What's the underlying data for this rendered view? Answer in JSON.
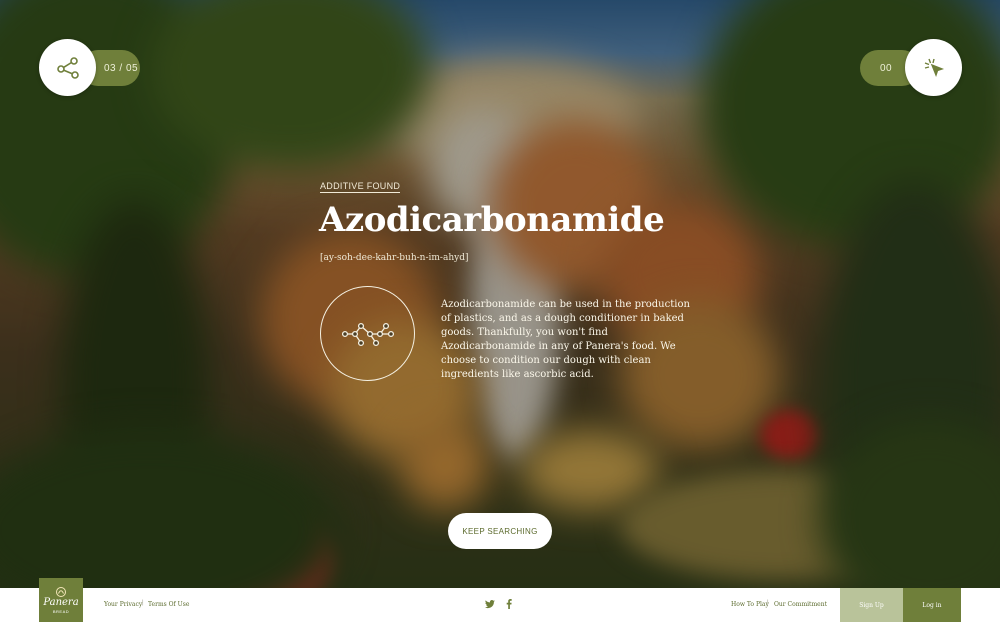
{
  "header": {
    "progress_label": "03 / 05",
    "found_count": "00",
    "share_icon": "share-network-icon",
    "cursor_icon": "cursor-sparkle-icon"
  },
  "main": {
    "eyebrow": "ADDITIVE FOUND",
    "title": "Azodicarbonamide",
    "pronunciation": "[ay-soh-dee-kahr-buh-n-im-ahyd]",
    "description": "Azodicarbonamide can be used in the production of plastics, and as a dough conditioner in baked goods. Thankfully, you won't find Azodicarbonamide in any of Panera's food. We choose to condition our dough with clean ingredients like ascorbic acid.",
    "molecule_icon": "molecule-icon",
    "cta_label": "KEEP SEARCHING"
  },
  "footer": {
    "logo_text": "Panera",
    "logo_sub": "BREAD",
    "links_left": [
      "Your Privacy",
      "Terms Of Use"
    ],
    "social": [
      "twitter-icon",
      "facebook-icon"
    ],
    "links_right": [
      "How To Play",
      "Our Commitment"
    ],
    "signup_label": "Sign Up",
    "login_label": "Log in"
  },
  "colors": {
    "brand_green": "#6f7f3a",
    "light_green": "#b9c39a",
    "sky": "#2c5f92"
  }
}
